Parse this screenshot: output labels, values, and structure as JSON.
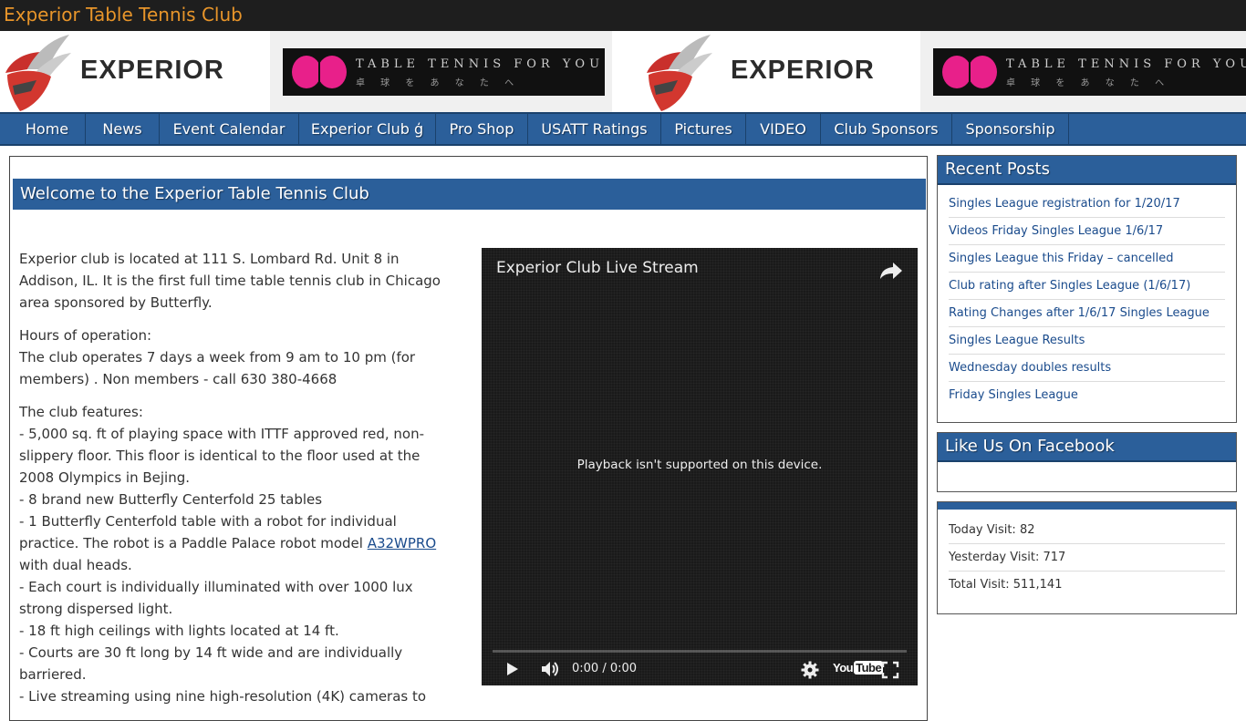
{
  "site": {
    "title": "Experior Table Tennis Club"
  },
  "banner": {
    "experior_text": "EXPERIOR",
    "butterfly_line1": "TABLE TENNIS FOR YOU",
    "butterfly_line2": "卓 球 を あ な た へ"
  },
  "nav": {
    "items": [
      {
        "label": "Home"
      },
      {
        "label": "News"
      },
      {
        "label": "Event Calendar"
      },
      {
        "label": "Experior Club ģ"
      },
      {
        "label": "Pro Shop"
      },
      {
        "label": "USATT Ratings"
      },
      {
        "label": "Pictures"
      },
      {
        "label": "VIDEO"
      },
      {
        "label": "Club Sponsors"
      },
      {
        "label": "Sponsorship"
      }
    ]
  },
  "main": {
    "title": "Welcome to the Experior Table Tennis Club",
    "paragraphs": [
      "Experior club is located at 111 S. Lombard Rd. Unit 8 in Addison, IL.  It is the first full time table tennis club in Chicago area sponsored by Butterfly.",
      "Hours of operation:",
      "The club operates 7 days a week from 9 am to 10 pm (for members) . Non members - call 630 380-4668",
      "The club features:",
      "- 5,000 sq. ft of playing space with ITTF approved red, non-slippery floor. This floor is identical to the floor used at the 2008 Olympics in Bejing.",
      "- 8 brand new Butterfly Centerfold 25 tables",
      "- 1 Butterfly Centerfold table with a robot for individual practice.  The robot is a Paddle Palace robot model ",
      "A32WPRO",
      "with dual heads.",
      "- Each court is individually illuminated with over 1000 lux strong dispersed light.",
      "- 18 ft high ceilings with lights located at 14 ft.",
      "- Courts are 30 ft long by 14 ft wide and are individually barriered.",
      "- Live streaming using nine high-resolution (4K) cameras to"
    ]
  },
  "video": {
    "title": "Experior Club Live Stream",
    "message": "Playback isn't supported on this device.",
    "time": "0:00 / 0:00",
    "youtube_you": "You",
    "youtube_tube": "Tube"
  },
  "sidebar": {
    "recent_posts": {
      "title": "Recent Posts",
      "items": [
        "Singles League registration for 1/20/17",
        "Videos Friday Singles League 1/6/17",
        "Singles League this Friday – cancelled",
        "Club rating after Singles League (1/6/17)",
        "Rating Changes after 1/6/17 Singles League",
        "Singles League Results",
        "Wednesday doubles results",
        "Friday Singles League"
      ]
    },
    "facebook": {
      "title": "Like Us On Facebook"
    },
    "stats": {
      "items": [
        "Today Visit: 82",
        "Yesterday Visit: 717",
        "Total Visit: 511,141"
      ]
    }
  }
}
